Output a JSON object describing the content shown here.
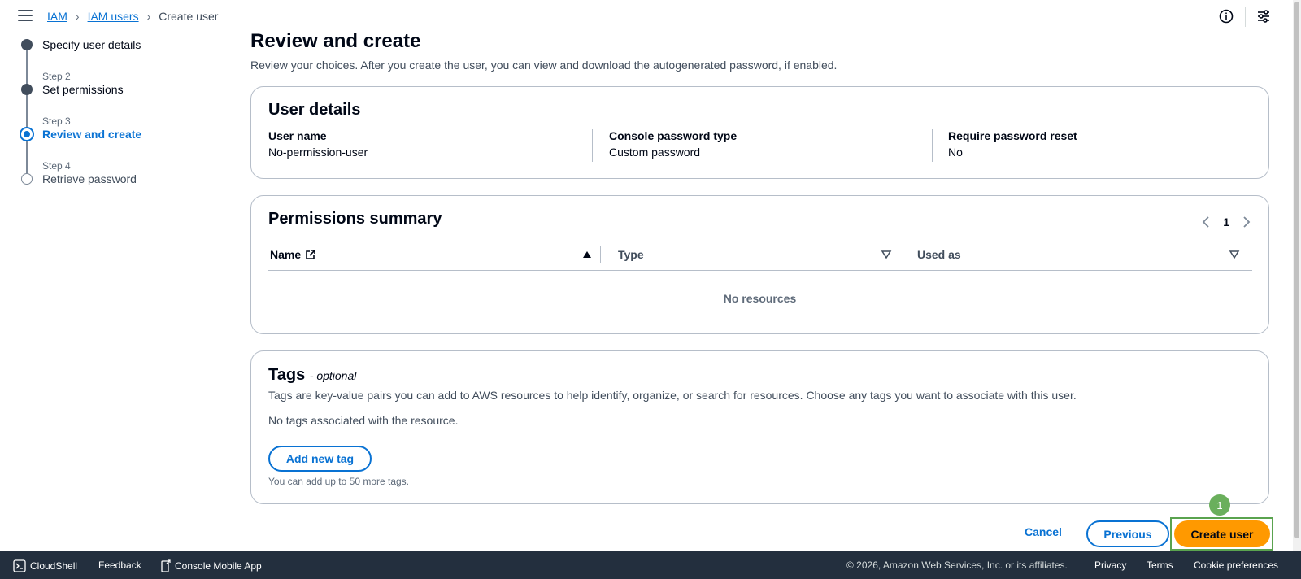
{
  "breadcrumb": {
    "items": [
      "IAM",
      "IAM users"
    ],
    "current": "Create user"
  },
  "stepper": {
    "steps": [
      {
        "step_label": "",
        "label": "Specify user details",
        "state": "done"
      },
      {
        "step_label": "Step 2",
        "label": "Set permissions",
        "state": "done"
      },
      {
        "step_label": "Step 3",
        "label": "Review and create",
        "state": "active"
      },
      {
        "step_label": "Step 4",
        "label": "Retrieve password",
        "state": "pending"
      }
    ]
  },
  "page": {
    "title": "Review and create",
    "description": "Review your choices. After you create the user, you can view and download the autogenerated password, if enabled."
  },
  "user_details": {
    "title": "User details",
    "fields": [
      {
        "key": "User name",
        "value": "No-permission-user"
      },
      {
        "key": "Console password type",
        "value": "Custom password"
      },
      {
        "key": "Require password reset",
        "value": "No"
      }
    ]
  },
  "permissions": {
    "title": "Permissions summary",
    "page_number": "1",
    "columns": [
      "Name",
      "Type",
      "Used as"
    ],
    "empty_text": "No resources"
  },
  "tags": {
    "title": "Tags",
    "optional": "- optional",
    "description": "Tags are key-value pairs you can add to AWS resources to help identify, organize, or search for resources. Choose any tags you want to associate with this user.",
    "empty_text": "No tags associated with the resource.",
    "add_button": "Add new tag",
    "hint": "You can add up to 50 more tags."
  },
  "actions": {
    "cancel": "Cancel",
    "previous": "Previous",
    "create": "Create user",
    "badge": "1"
  },
  "footer": {
    "cloudshell": "CloudShell",
    "feedback": "Feedback",
    "mobile_app": "Console Mobile App",
    "copyright": "© 2026, Amazon Web Services, Inc. or its affiliates.",
    "privacy": "Privacy",
    "terms": "Terms",
    "cookies": "Cookie preferences"
  },
  "colors": {
    "link": "#0972d3",
    "primary_button": "#ff9900",
    "footer_bg": "#232f3e",
    "highlight": "#5aa34f"
  }
}
